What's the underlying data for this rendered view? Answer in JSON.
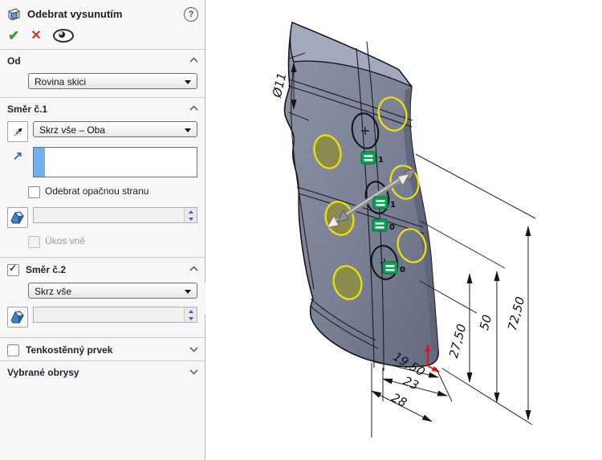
{
  "panel": {
    "title": "Odebrat vysunutím",
    "help_glyph": "?",
    "ok_glyph": "✔",
    "cancel_glyph": "✕",
    "od": {
      "label": "Od",
      "value": "Rovina skici"
    },
    "dir1": {
      "label": "Směr č.1",
      "end_condition": "Skrz vše – Oba",
      "selection_value": "",
      "flip_label": "Odebrat opačnou stranu",
      "draft_value": "",
      "draft_outward_label": "Úkos vně"
    },
    "dir2": {
      "label": "Směr č.2",
      "end_condition": "Skrz vše",
      "draft_value": ""
    },
    "thin_feature": {
      "label": "Tenkostěnný prvek"
    },
    "selected_contours": {
      "label": "Vybrané obrysy"
    }
  },
  "model": {
    "dimensions": {
      "diameter": "Ø11",
      "height_total": "72,50",
      "height_mid": "50",
      "height_low": "27,50",
      "width_small": "19,50",
      "width_mid": "23",
      "width_large": "28"
    },
    "relation_badges": [
      {
        "glyph": "=",
        "count": "1"
      },
      {
        "glyph": "=",
        "count": "1"
      },
      {
        "glyph": "=",
        "count": "0"
      },
      {
        "glyph": "=",
        "count": "0"
      }
    ]
  },
  "colors": {
    "sketch_yellow": "#f0e400",
    "relation_green": "#00a651",
    "origin_red": "#e21414",
    "selection_blue": "#72adf1",
    "body_gray": "#7e8498"
  }
}
